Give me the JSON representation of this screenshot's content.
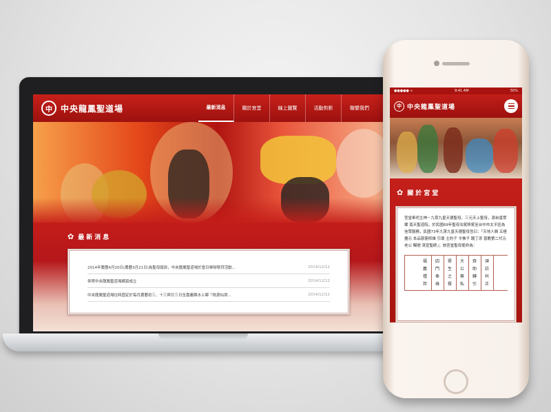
{
  "site": {
    "name": "中央龍鳳聖道場",
    "logo_glyph": "中"
  },
  "desktop": {
    "nav": [
      "最新消息",
      "關於宮堂",
      "線上圖覽",
      "活動剪影",
      "聯繫我們"
    ],
    "news": {
      "title": "最新消息",
      "items": [
        {
          "text": "2014年農曆4月20日(農曆3月21日)為聖母誕辰，中央龍鳳聖道場於當日舉辦祭拜活動…",
          "date": "2014/12/12"
        },
        {
          "text": "恭賀中央龍鳳聖道場網頁成立",
          "date": "2014/12/12"
        },
        {
          "text": "中央龍鳳聖道場往時固定於每月農曆初三、十三與廿三日至嘉義縣水上鄉「桃源仙境…",
          "date": "2014/12/12"
        }
      ]
    }
  },
  "mobile": {
    "status": {
      "left": "●●●●● ≈",
      "time": "9:41 AM",
      "battery": "50%"
    },
    "about": {
      "title": "關於宮堂",
      "text": "宮堂奉祀主神－九霄九皇天德聖母，三元天上聖母，源自皇眾鄉 南天聖道院，於民國69年聖母法駕移駕至台中市太平區為信眾服務，民國73年九霄九皇天德聖母旨曰：「天地人間 五極盡元 本品慈靈修維 引導 主的子 令佛子 踐丁添 普瞻第二代元老公 賜號 清宣聖師」；該宮堂聖母使命為：",
      "columns": [
        "福義禮邦",
        "四門奉祿",
        "眾生之餐",
        "大公無私",
        "齊助轉引",
        "頌訪糾正"
      ]
    }
  },
  "colors": {
    "brand": "#b51714",
    "accent": "#ffffff"
  }
}
